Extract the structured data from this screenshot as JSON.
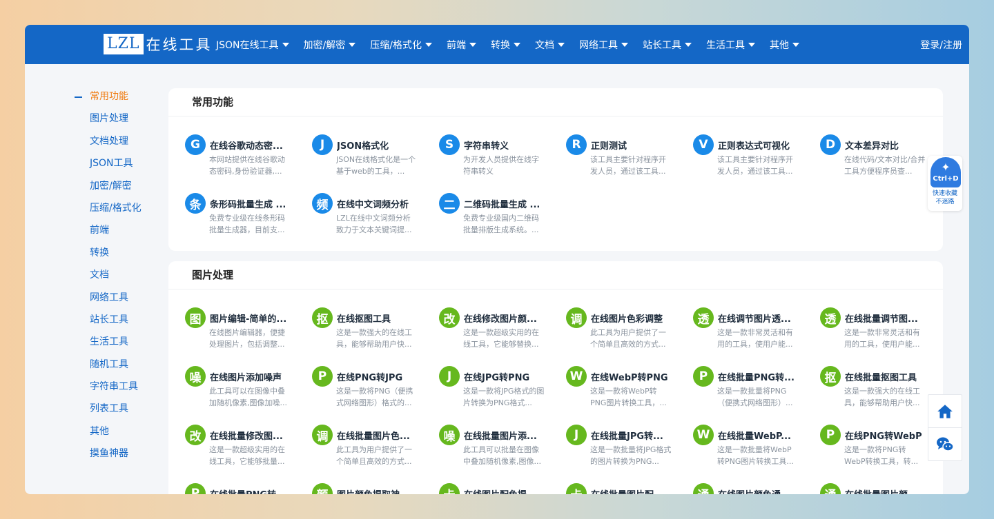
{
  "logo": {
    "box": "LZL",
    "text": "在线工具"
  },
  "nav": [
    "JSON在线工具",
    "加密/解密",
    "压缩/格式化",
    "前端",
    "转换",
    "文档",
    "网络工具",
    "站长工具",
    "生活工具",
    "其他"
  ],
  "login": "登录/注册",
  "sidebar": [
    "常用功能",
    "图片处理",
    "文档处理",
    "JSON工具",
    "加密/解密",
    "压缩/格式化",
    "前端",
    "转换",
    "文档",
    "网络工具",
    "站长工具",
    "生活工具",
    "随机工具",
    "字符串工具",
    "列表工具",
    "其他",
    "摸鱼神器"
  ],
  "sections": [
    {
      "title": "常用功能",
      "tools": [
        {
          "icon": "G",
          "color": "blue",
          "name": "在线谷歌动态密...",
          "desc": "本网站提供在线谷歌动态密码,身份验证器,..."
        },
        {
          "icon": "J",
          "color": "blue",
          "name": "JSON格式化",
          "desc": "JSON在线格式化是一个基于web的工具，..."
        },
        {
          "icon": "S",
          "color": "blue",
          "name": "字符串转义",
          "desc": "为开发人员提供在线字符串转义"
        },
        {
          "icon": "R",
          "color": "blue",
          "name": "正则测试",
          "desc": "该工具主要针对程序开发人员，通过该工具..."
        },
        {
          "icon": "V",
          "color": "blue",
          "name": "正则表达式可视化",
          "desc": "该工具主要针对程序开发人员，通过该工具..."
        },
        {
          "icon": "D",
          "color": "blue",
          "name": "文本差异对比",
          "desc": "在线代码/文本对比/合并工具方便程序员查..."
        },
        {
          "icon": "条",
          "color": "blue",
          "name": "条形码批量生成 ...",
          "desc": "免费专业级在线条形码批量生成器，目前支..."
        },
        {
          "icon": "频",
          "color": "blue",
          "name": "在线中文词频分析",
          "desc": "LZL在线中文词频分析致力于文本关键词提..."
        },
        {
          "icon": "二",
          "color": "blue",
          "name": "二维码批量生成 ...",
          "desc": "免费专业级国内二维码批量排版生成系统。..."
        }
      ]
    },
    {
      "title": "图片处理",
      "tools": [
        {
          "icon": "图",
          "color": "green",
          "name": "图片编辑-简单的...",
          "desc": "在线图片编辑器，便捷处理图片，包括调整..."
        },
        {
          "icon": "抠",
          "color": "green",
          "name": "在线抠图工具",
          "desc": "这是一款强大的在线工具，能够帮助用户快..."
        },
        {
          "icon": "改",
          "color": "green",
          "name": "在线修改图片颜...",
          "desc": "这是一款超级实用的在线工具，它能够替换..."
        },
        {
          "icon": "调",
          "color": "green",
          "name": "在线图片色彩调整",
          "desc": "此工具为用户提供了一个简单且高效的方式..."
        },
        {
          "icon": "透",
          "color": "green",
          "name": "在线调节图片透...",
          "desc": "这是一款非常灵活和有用的工具，使用户能..."
        },
        {
          "icon": "透",
          "color": "green",
          "name": "在线批量调节图...",
          "desc": "这是一款非常灵活和有用的工具，使用户能..."
        },
        {
          "icon": "噪",
          "color": "green",
          "name": "在线图片添加噪声",
          "desc": "此工具可以在图像中叠加随机像素,图像加噪..."
        },
        {
          "icon": "P",
          "color": "green",
          "name": "在线PNG转JPG",
          "desc": "这是一款将PNG（便携式网络图形）格式的..."
        },
        {
          "icon": "J",
          "color": "green",
          "name": "在线JPG转PNG",
          "desc": "这是一款将JPG格式的图片转换为PNG格式..."
        },
        {
          "icon": "W",
          "color": "green",
          "name": "在线WebP转PNG",
          "desc": "这是一款将WebP转PNG图片转换工具，..."
        },
        {
          "icon": "P",
          "color": "green",
          "name": "在线批量PNG转...",
          "desc": "这是一款批量将PNG（便携式网络图形）..."
        },
        {
          "icon": "抠",
          "color": "green",
          "name": "在线批量抠图工具",
          "desc": "这是一款强大的在线工具，能够帮助用户快..."
        },
        {
          "icon": "改",
          "color": "green",
          "name": "在线批量修改图...",
          "desc": "这是一款超级实用的在线工具，它能够批量..."
        },
        {
          "icon": "调",
          "color": "green",
          "name": "在线批量图片色...",
          "desc": "此工具为用户提供了一个简单且高效的方式..."
        },
        {
          "icon": "噪",
          "color": "green",
          "name": "在线批量图片添...",
          "desc": "此工具可以批量在图像中叠加随机像素,图像..."
        },
        {
          "icon": "J",
          "color": "green",
          "name": "在线批量JPG转...",
          "desc": "这是一款批量将JPG格式的图片转换为PNG..."
        },
        {
          "icon": "W",
          "color": "green",
          "name": "在线批量WebP...",
          "desc": "这是一款批量将WebP转PNG图片转换工具..."
        },
        {
          "icon": "P",
          "color": "green",
          "name": "在线PNG转WebP",
          "desc": "这是一款将PNG转WebP转换工具，转..."
        },
        {
          "icon": "P",
          "color": "green",
          "name": "在线批量PNG转...",
          "desc": ""
        },
        {
          "icon": "颜",
          "color": "green",
          "name": "图片颜色提取神...",
          "desc": ""
        },
        {
          "icon": "卡",
          "color": "green",
          "name": "在线图片配色提...",
          "desc": ""
        },
        {
          "icon": "卡",
          "color": "green",
          "name": "在线批量图片配...",
          "desc": ""
        },
        {
          "icon": "通",
          "color": "green",
          "name": "在线图片颜色通...",
          "desc": ""
        },
        {
          "icon": "通",
          "color": "green",
          "name": "在线批量图片颜...",
          "desc": ""
        }
      ]
    }
  ],
  "bookmark": {
    "badge": "Ctrl+D",
    "line1": "快速收藏",
    "line2": "不迷路"
  },
  "colors": {
    "nav": "#1467c6",
    "active": "#f07c12",
    "icon_blue": "#1a8ae8",
    "icon_green": "#66b81e"
  }
}
